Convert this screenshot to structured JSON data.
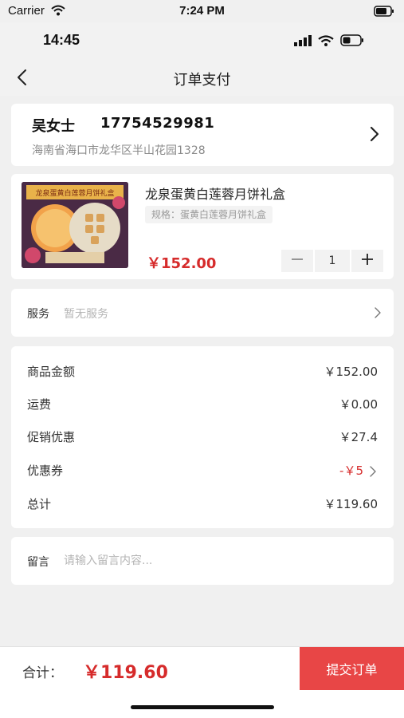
{
  "device_status": {
    "carrier": "Carrier",
    "time": "7:24 PM"
  },
  "app_status": {
    "time": "14:45"
  },
  "nav": {
    "title": "订单支付"
  },
  "address": {
    "name": "吴女士",
    "phone": "17754529981",
    "detail": "海南省海口市龙华区半山花园1328"
  },
  "product": {
    "image_caption": "龙泉蛋黄白莲蓉月饼礼盒",
    "name": "龙泉蛋黄白莲蓉月饼礼盒",
    "spec": "规格：蛋黄白莲蓉月饼礼盒",
    "price": "￥152.00",
    "quantity": "1"
  },
  "service": {
    "label": "服务",
    "value": "暂无服务"
  },
  "summary": {
    "goods_amount_label": "商品金额",
    "goods_amount": "￥152.00",
    "shipping_label": "运费",
    "shipping": "￥0.00",
    "promotion_label": "促销优惠",
    "promotion": "￥27.4",
    "coupon_label": "优惠券",
    "coupon": "-￥5",
    "total_label": "总计",
    "total": "￥119.60"
  },
  "message": {
    "label": "留言",
    "placeholder": "请输入留言内容..."
  },
  "footer": {
    "total_label": "合计：",
    "total_value": "￥119.60",
    "submit_label": "提交订单"
  },
  "colors": {
    "accent": "#d62b2b",
    "submit_bg": "#e84646",
    "background": "#f0f0f0"
  }
}
